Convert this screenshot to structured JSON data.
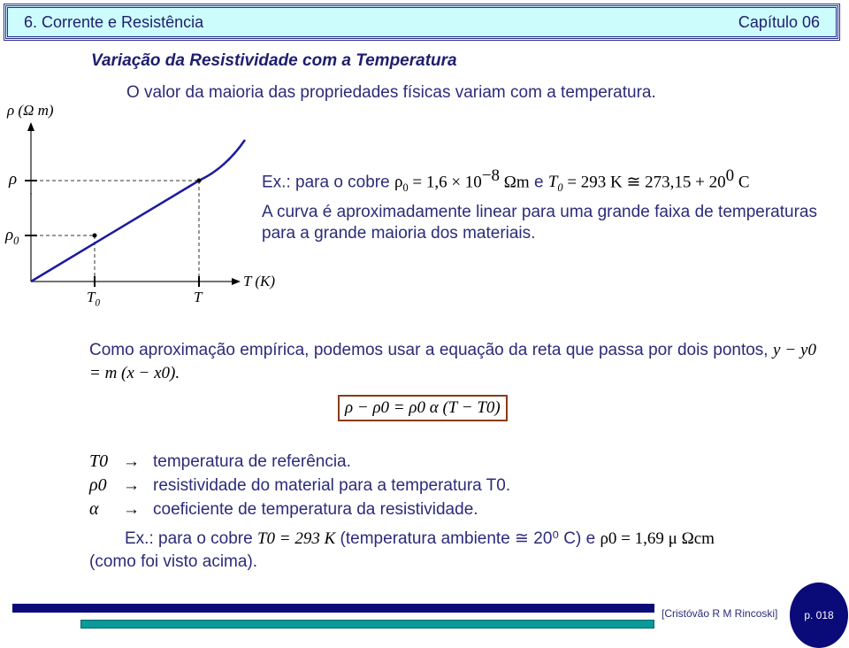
{
  "header": {
    "chapter_title": "6. Corrente e Resistência",
    "chapter_number": "Capítulo 06"
  },
  "section_title": "Variação da Resistividade com a Temperatura",
  "intro_text": "O valor da maioria das propriedades físicas variam com a temperatura.",
  "graph": {
    "y_axis_label": "ρ (Ω m)",
    "x_axis_label": "T (K)",
    "y_ticks": [
      "ρ",
      "ρ0"
    ],
    "x_ticks": [
      "T0",
      "T"
    ],
    "curve_color": "#1a1aa0"
  },
  "example1": {
    "prefix": "Ex.: para o cobre ",
    "rho0_symbol": "ρ",
    "rho0_value": " = 1,6 × 10",
    "exponent": "−8",
    "unit": " Ωm",
    "connector": " e ",
    "T0_symbol": "T",
    "T0_value": " = 293 K ≅ 273,15 + 20",
    "deg": "0",
    "celsius": " C"
  },
  "paragraph1": "A curva é aproximadamente linear para uma grande faixa de temperaturas para a grande maioria dos materiais.",
  "paragraph2": {
    "text": "Como aproximação empírica, podemos usar a equação da reta que passa por dois pontos, ",
    "equation": "y − y0 = m (x − x0)."
  },
  "boxed_equation": "ρ − ρ0 = ρ0 α (T − T0)",
  "definitions": [
    {
      "symbol": "T0",
      "arrow": "→",
      "text": "temperatura de referência."
    },
    {
      "symbol": "ρ0",
      "arrow": "→",
      "text": "resistividade do material para a temperatura T0."
    },
    {
      "symbol": "α",
      "arrow": "→",
      "text": "coeficiente de temperatura da resistividade."
    }
  ],
  "example2": {
    "prefix": "Ex.: para o cobre ",
    "T0": "T0 = 293 K",
    "middle": " (temperatura ambiente ≅ 20⁰ C) e ",
    "rho0": "ρ0 = 1,69 μ Ωcm",
    "suffix": "(como foi visto acima)."
  },
  "footer": {
    "author": "[Cristóvão R M Rincoski]",
    "page": "p. 018",
    "bar_colors": [
      "#0a0a78",
      "#0a9a9a"
    ]
  }
}
